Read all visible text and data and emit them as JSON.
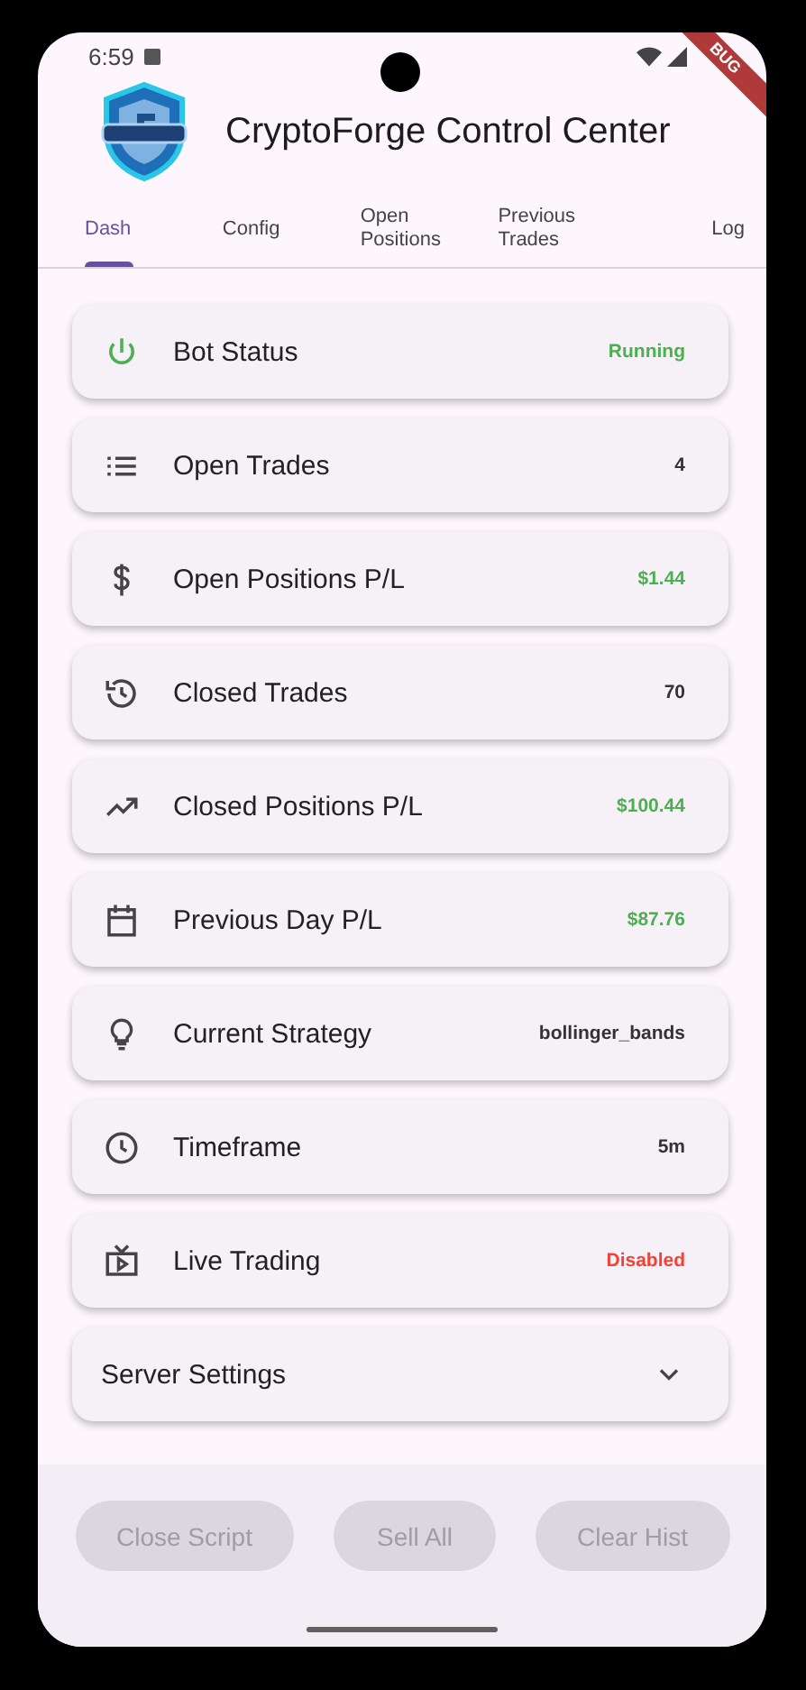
{
  "status_bar": {
    "time": "6:59"
  },
  "debug_banner": "BUG",
  "app_bar": {
    "title": "CryptoForge Control Center"
  },
  "tabs": [
    {
      "label": "Dash",
      "selected": true
    },
    {
      "label": "Config",
      "selected": false
    },
    {
      "label": "Open\nPositions",
      "selected": false
    },
    {
      "label": "Previous\nTrades",
      "selected": false
    },
    {
      "label": "Log",
      "selected": false
    }
  ],
  "cards": [
    {
      "label": "Bot Status",
      "value": "Running",
      "color": "#4caf50"
    },
    {
      "label": "Open Trades",
      "value": "4",
      "color": "#333333"
    },
    {
      "label": "Open Positions P/L",
      "value": "$1.44",
      "color": "#4caf50"
    },
    {
      "label": "Closed Trades",
      "value": "70",
      "color": "#333333"
    },
    {
      "label": "Closed Positions P/L",
      "value": "$100.44",
      "color": "#4caf50"
    },
    {
      "label": "Previous Day P/L",
      "value": "$87.76",
      "color": "#4caf50"
    },
    {
      "label": "Current Strategy",
      "value": "bollinger_bands",
      "color": "#333333"
    },
    {
      "label": "Timeframe",
      "value": "5m",
      "color": "#333333"
    },
    {
      "label": "Live Trading",
      "value": "Disabled",
      "color": "#f44336"
    }
  ],
  "server_settings": {
    "label": "Server Settings",
    "expanded": false
  },
  "buttons": [
    {
      "label": "Close Script",
      "disabled": true
    },
    {
      "label": "Sell All",
      "disabled": true
    },
    {
      "label": "Clear Hist",
      "disabled": true
    }
  ]
}
